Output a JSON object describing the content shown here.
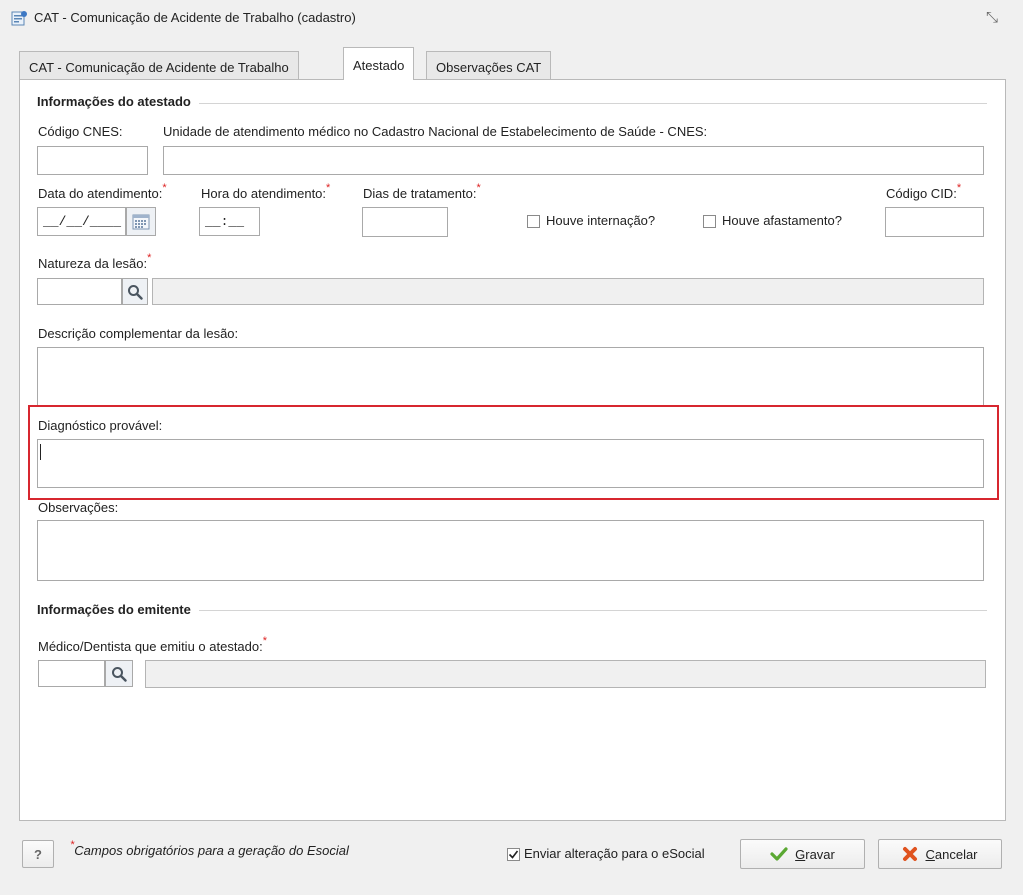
{
  "window": {
    "title": "CAT - Comunicação de Acidente de Trabalho (cadastro)",
    "close_glyph": "⤡"
  },
  "tabs": [
    {
      "label": "CAT - Comunicação de Acidente de Trabalho",
      "active": false
    },
    {
      "label": "Atestado",
      "active": true
    },
    {
      "label": "Observações CAT",
      "active": false
    }
  ],
  "atestado": {
    "section_title": "Informações do atestado",
    "codigo_cnes_label": "Código CNES:",
    "codigo_cnes_value": "",
    "unidade_label": "Unidade de atendimento médico no Cadastro Nacional de Estabelecimento de Saúde - CNES:",
    "unidade_value": "",
    "data_label": "Data do atendimento:",
    "data_value": "__/__/____",
    "hora_label": "Hora do atendimento:",
    "hora_value": "__:__",
    "dias_label": "Dias de tratamento:",
    "dias_value": "",
    "internacao_label": "Houve internação?",
    "internacao_checked": false,
    "afastamento_label": "Houve afastamento?",
    "afastamento_checked": false,
    "cid_label": "Código CID:",
    "cid_value": "",
    "natureza_label": "Natureza da lesão:",
    "natureza_code": "",
    "natureza_desc": "",
    "descricao_label": "Descrição complementar da lesão:",
    "descricao_value": "",
    "diagnostico_label": "Diagnóstico provável:",
    "diagnostico_value": "",
    "observacoes_label": "Observações:",
    "observacoes_value": "",
    "required_mark": "*"
  },
  "emitente": {
    "section_title": "Informações do emitente",
    "medico_label": "Médico/Dentista que emitiu o atestado:",
    "medico_code": "",
    "medico_name": ""
  },
  "footer": {
    "help_label": "?",
    "required_note": "Campos obrigatórios para a geração do Esocial",
    "esocial_label": "Enviar alteração para o eSocial",
    "esocial_checked": true,
    "save_label_first": "G",
    "save_label_rest": "ravar",
    "cancel_label_first": "C",
    "cancel_label_rest": "ancelar"
  },
  "colors": {
    "highlight": "#d7262f",
    "required": "#dd2222",
    "save_icon": "#5aa832",
    "cancel_icon": "#e0531f"
  }
}
